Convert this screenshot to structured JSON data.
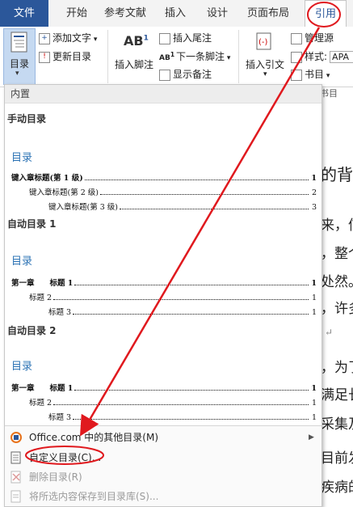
{
  "tabs": {
    "file": "文件",
    "home": "开始",
    "references_doc": "参考文献",
    "insert": "插入",
    "design": "设计",
    "layout": "页面布局",
    "references": "引用"
  },
  "ribbon": {
    "toc": "目录",
    "add_text": "添加文字",
    "update_toc": "更新目录",
    "insert_footnote": "插入脚注",
    "insert_endnote": "插入尾注",
    "next_footnote": "下一条脚注",
    "show_notes": "显示备注",
    "insert_citation": "插入引文",
    "manage_sources": "管理源",
    "style_label": "样式:",
    "style_value": "APA",
    "bibliography": "书目",
    "group_label": "书目"
  },
  "document": {
    "l1": "的背",
    "l2": "来，信",
    "l3": "，整个",
    "l4": "处然。",
    "l5": "，许多",
    "l6": "↵",
    "l7": "，为了",
    "l8": "满足长",
    "l9": "采集及",
    "l10": "目前发",
    "l11": "疾病的"
  },
  "menu": {
    "header": "内置",
    "manual_title": "手动目录",
    "manual_toc_heading": "目录",
    "manual_lines": [
      {
        "text": "键入章标题(第 1 级)",
        "num": "1"
      },
      {
        "text": "键入章标题(第 2 级)",
        "num": "2"
      },
      {
        "text": "键入章标题(第 3 级)",
        "num": "3"
      }
    ],
    "auto1_title": "自动目录 1",
    "auto1_toc_heading": "目录",
    "auto1_lines": [
      {
        "text": "第一章　　标题 1",
        "num": "1"
      },
      {
        "text": "标题 2",
        "num": "1"
      },
      {
        "text": "标题 3",
        "num": "1"
      }
    ],
    "auto2_title": "自动目录 2",
    "auto2_toc_heading": "目录",
    "auto2_lines": [
      {
        "text": "第一章　　标题 1",
        "num": "1"
      },
      {
        "text": "标题 2",
        "num": "1"
      },
      {
        "text": "标题 3",
        "num": "1"
      }
    ],
    "more_toc": "Office.com 中的其他目录(M)",
    "custom_toc": "自定义目录(C)...",
    "remove_toc": "删除目录(R)",
    "save_selection": "将所选内容保存到目录库(S)..."
  },
  "colors": {
    "accent": "#2b579a",
    "toc_heading": "#2e74b5",
    "annotation": "#e0191e"
  }
}
